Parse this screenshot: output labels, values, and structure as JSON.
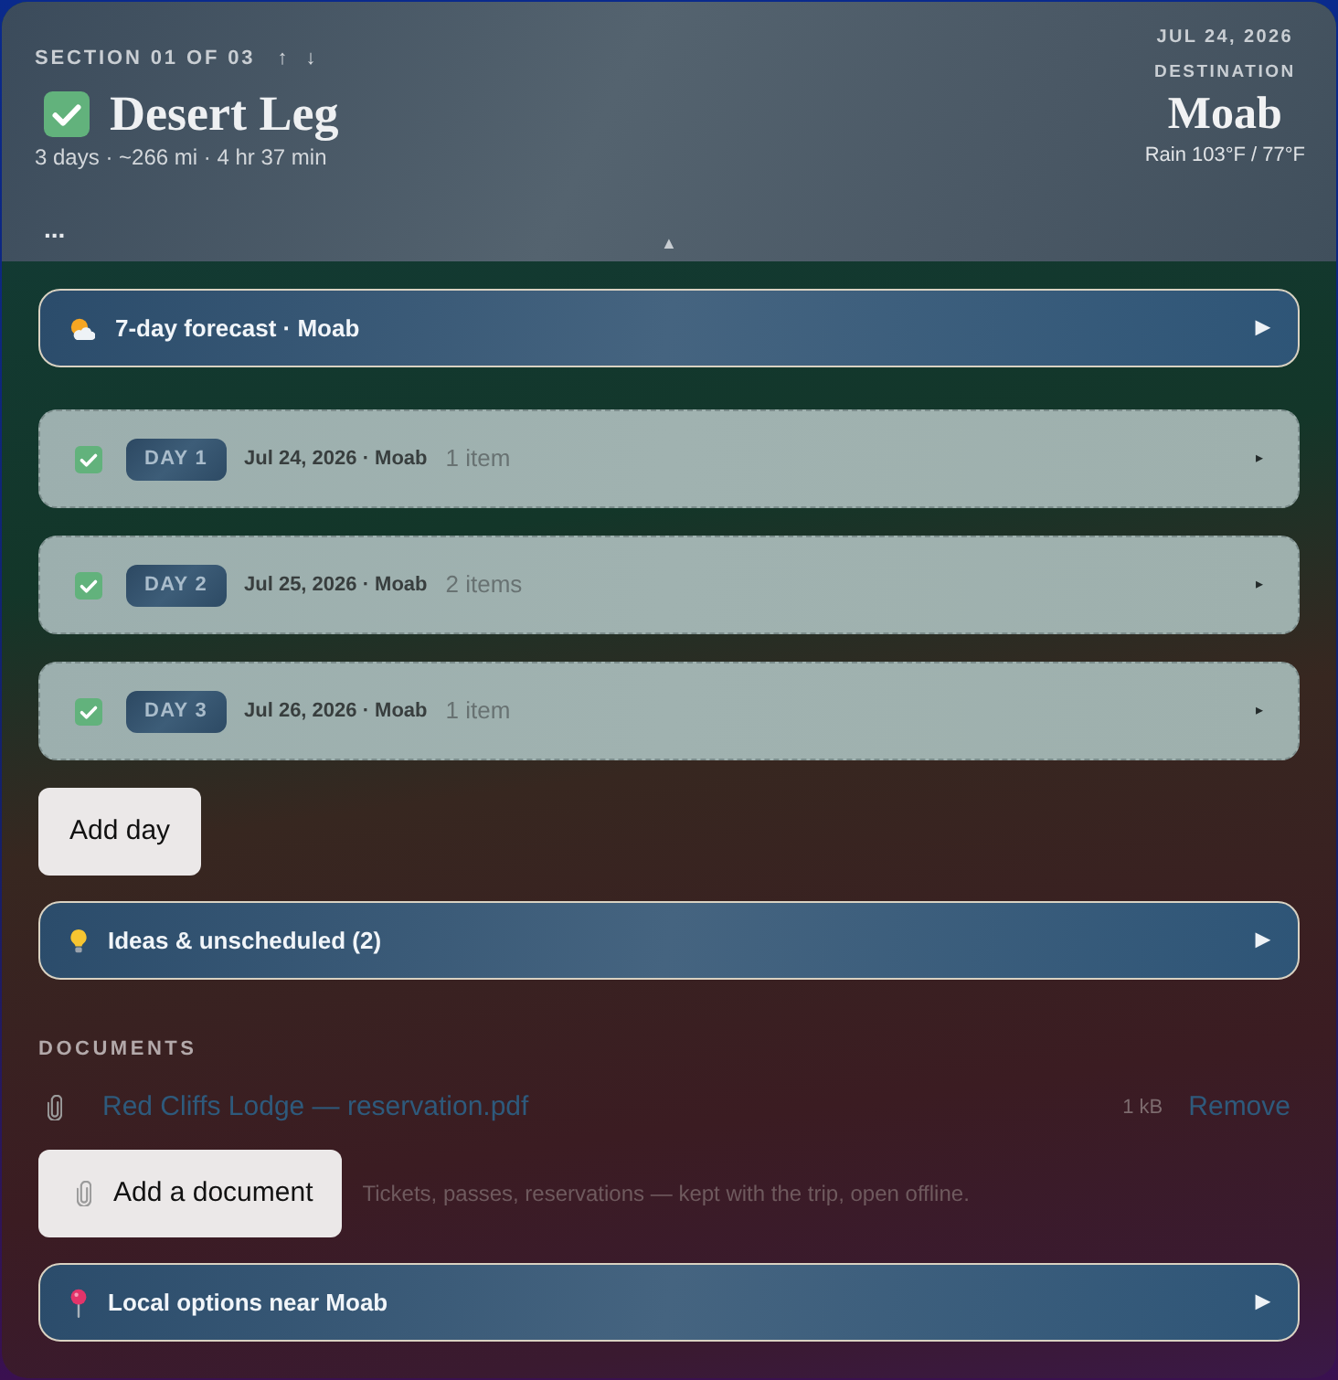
{
  "header": {
    "section_label": "SECTION 01 OF 03",
    "move_up": "↑",
    "move_down": "↓",
    "completed": true,
    "title": "Desert Leg",
    "summary": "3 days · ~266 mi · 4 hr 37 min",
    "more": "...",
    "collapse": "▲",
    "date": "JUL 24, 2026",
    "destination_label": "DESTINATION",
    "destination": "Moab",
    "weather": "Rain 103°F / 77°F"
  },
  "forecast_panel": {
    "kind": "weather",
    "label": "7-day forecast · Moab",
    "toggle": "▶"
  },
  "days": [
    {
      "checked": true,
      "badge": "DAY 1",
      "date": "Jul 24, 2026 · Moab",
      "count": "1 item",
      "toggle": "▸"
    },
    {
      "checked": true,
      "badge": "DAY 2",
      "date": "Jul 25, 2026 · Moab",
      "count": "2 items",
      "toggle": "▸"
    },
    {
      "checked": true,
      "badge": "DAY 3",
      "date": "Jul 26, 2026 · Moab",
      "count": "1 item",
      "toggle": "▸"
    }
  ],
  "add_day_button": "Add day",
  "ideas_panel": {
    "kind": "ideas",
    "label": "Ideas & unscheduled (2)",
    "toggle": "▶"
  },
  "documents": {
    "heading": "DOCUMENTS",
    "files": [
      {
        "name": "Red Cliffs Lodge — reservation.pdf",
        "size": "1 kB",
        "action": "Remove"
      }
    ],
    "add_button": "Add a document",
    "hint": "Tickets, passes, reservations — kept with the trip, open offline."
  },
  "local_panel": {
    "kind": "places",
    "label": "Local options near Moab",
    "toggle": "▶"
  }
}
